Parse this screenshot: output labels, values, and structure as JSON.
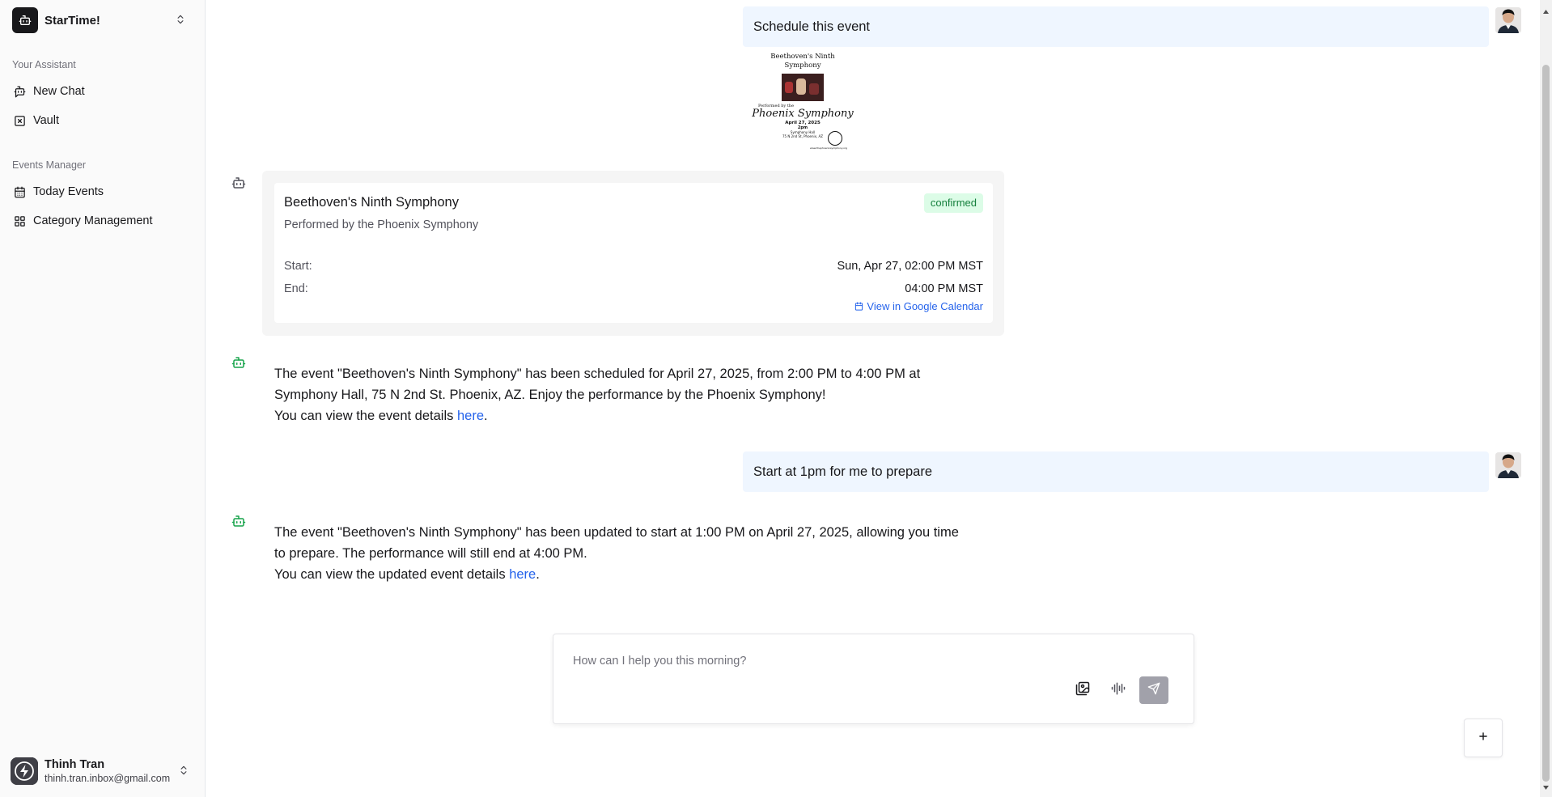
{
  "app": {
    "name": "StarTime!",
    "logo_icon": "robot-icon"
  },
  "sidebar": {
    "groups": [
      {
        "label": "Your Assistant",
        "items": [
          {
            "label": "New Chat",
            "icon": "chat-bot-icon"
          },
          {
            "label": "Vault",
            "icon": "vault-icon"
          }
        ]
      },
      {
        "label": "Events Manager",
        "items": [
          {
            "label": "Today Events",
            "icon": "calendar-icon"
          },
          {
            "label": "Category Management",
            "icon": "grid-icon"
          }
        ]
      }
    ],
    "user": {
      "name": "Thinh Tran",
      "email": "thinh.tran.inbox@gmail.com"
    }
  },
  "chat": {
    "messages": [
      {
        "role": "user",
        "text": "Schedule this event",
        "attachment": {
          "title_line1": "Beethoven's Ninth",
          "title_line2": "Symphony",
          "performed_by": "Performed by the",
          "orchestra": "Phoenix Symphony",
          "date": "April 27, 2025",
          "time": "2pm",
          "venue": "Symphony Hall",
          "address": "75 N 2nd St, Phoenix, AZ",
          "website": "www.thephoenixsymphony.org"
        }
      },
      {
        "role": "assistant",
        "card": {
          "title": "Beethoven's Ninth Symphony",
          "subtitle": "Performed by the Phoenix Symphony",
          "status": "confirmed",
          "start_label": "Start:",
          "start_value": "Sun, Apr 27, 02:00 PM MST",
          "end_label": "End:",
          "end_value": "04:00 PM MST",
          "link_label": "View in Google Calendar"
        }
      },
      {
        "role": "assistant",
        "line1": "The event \"Beethoven's Ninth Symphony\" has been scheduled for April 27, 2025, from 2:00 PM to 4:00 PM at",
        "line2": "Symphony Hall, 75 N 2nd St. Phoenix, AZ. Enjoy the performance by the Phoenix Symphony!",
        "line3_prefix": "You can view the event details ",
        "link": "here",
        "line3_suffix": "."
      },
      {
        "role": "user",
        "text": "Start at 1pm for me to prepare"
      },
      {
        "role": "assistant",
        "line1": "The event \"Beethoven's Ninth Symphony\" has been updated to start at 1:00 PM on April 27, 2025, allowing you time",
        "line2": "to prepare. The performance will still end at 4:00 PM.",
        "line3_prefix": "You can view the updated event details ",
        "link": "here",
        "line3_suffix": "."
      }
    ]
  },
  "composer": {
    "placeholder": "How can I help you this morning?",
    "buttons": [
      "image-upload-icon",
      "voice-input-icon",
      "send-icon"
    ]
  },
  "colors": {
    "accent": "#2563eb",
    "user_bubble": "#eff6ff",
    "badge_bg": "#dcfce7",
    "badge_text": "#15803d",
    "bot_icon_active": "#16a34a"
  }
}
